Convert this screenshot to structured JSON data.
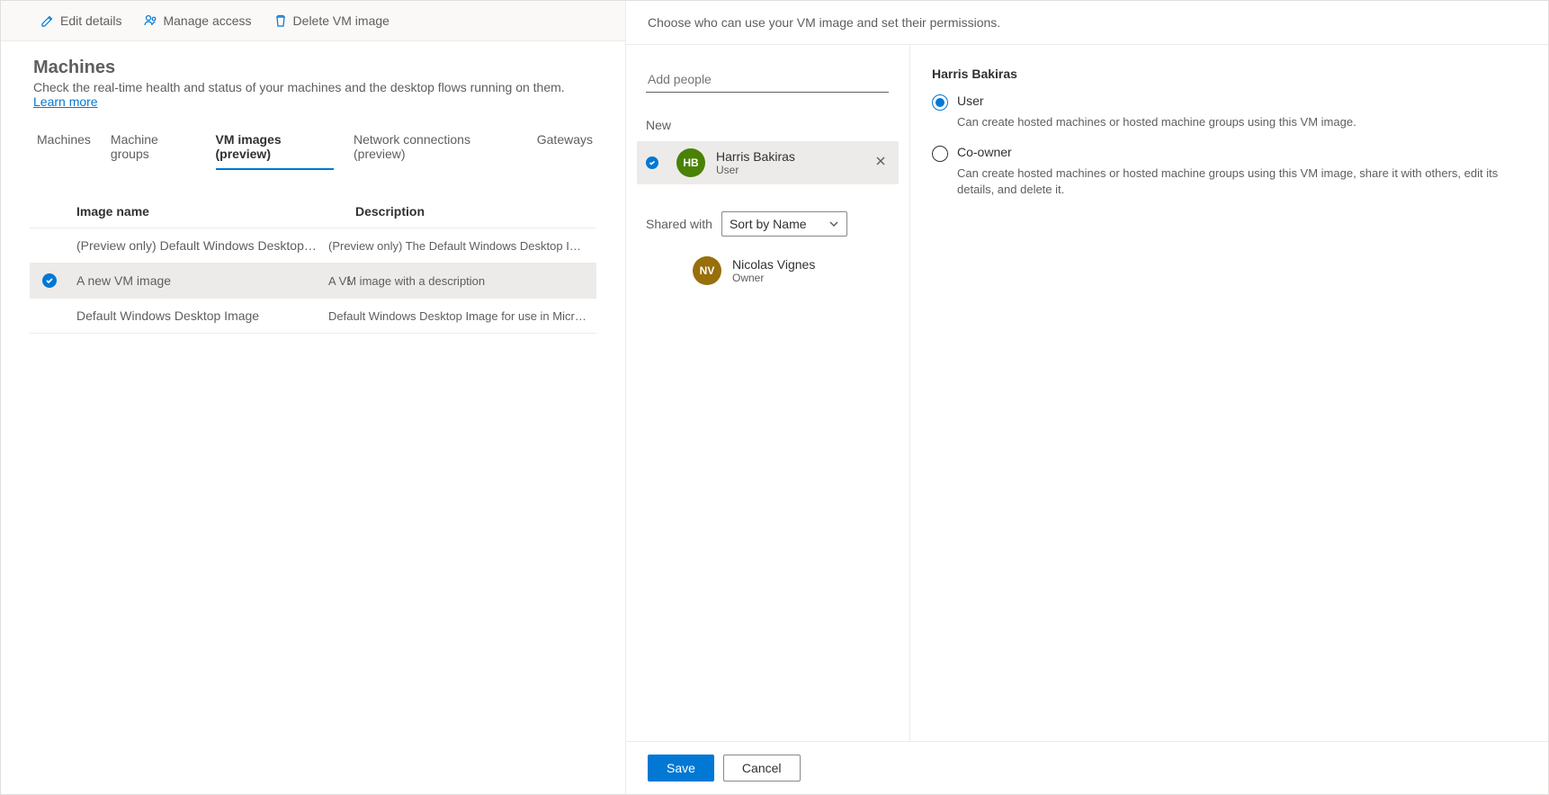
{
  "toolbar": {
    "edit": "Edit details",
    "manage": "Manage access",
    "delete": "Delete VM image"
  },
  "page": {
    "title": "Machines",
    "subtitle_prefix": "Check the real-time health and status of your machines and the desktop flows running on them. ",
    "learn_more": "Learn more"
  },
  "tabs": [
    "Machines",
    "Machine groups",
    "VM images (preview)",
    "Network connections (preview)",
    "Gateways"
  ],
  "active_tab_index": 2,
  "columns": {
    "name": "Image name",
    "description": "Description"
  },
  "rows": [
    {
      "name": "(Preview only) Default Windows Desktop Ima...",
      "desc": "(Preview only) The Default Windows Desktop Image for use i...",
      "selected": false
    },
    {
      "name": "A new VM image",
      "desc": "A VM image with a description",
      "selected": true
    },
    {
      "name": "Default Windows Desktop Image",
      "desc": "Default Windows Desktop Image for use in Microsoft Deskto...",
      "selected": false
    }
  ],
  "panel": {
    "header": "Choose who can use your VM image and set their permissions.",
    "add_people_placeholder": "Add people",
    "new_label": "New",
    "shared_with_label": "Shared with",
    "sort_label": "Sort by Name",
    "new_people": [
      {
        "initials": "HB",
        "name": "Harris Bakiras",
        "role": "User",
        "avatar_color": "green"
      }
    ],
    "shared_people": [
      {
        "initials": "NV",
        "name": "Nicolas Vignes",
        "role": "Owner",
        "avatar_color": "gold"
      }
    ],
    "perm_target": "Harris Bakiras",
    "permissions": [
      {
        "key": "user",
        "label": "User",
        "desc": "Can create hosted machines or hosted machine groups using this VM image.",
        "checked": true
      },
      {
        "key": "coowner",
        "label": "Co-owner",
        "desc": "Can create hosted machines or hosted machine groups using this VM image, share it with others, edit its details, and delete it.",
        "checked": false
      }
    ],
    "save": "Save",
    "cancel": "Cancel"
  }
}
